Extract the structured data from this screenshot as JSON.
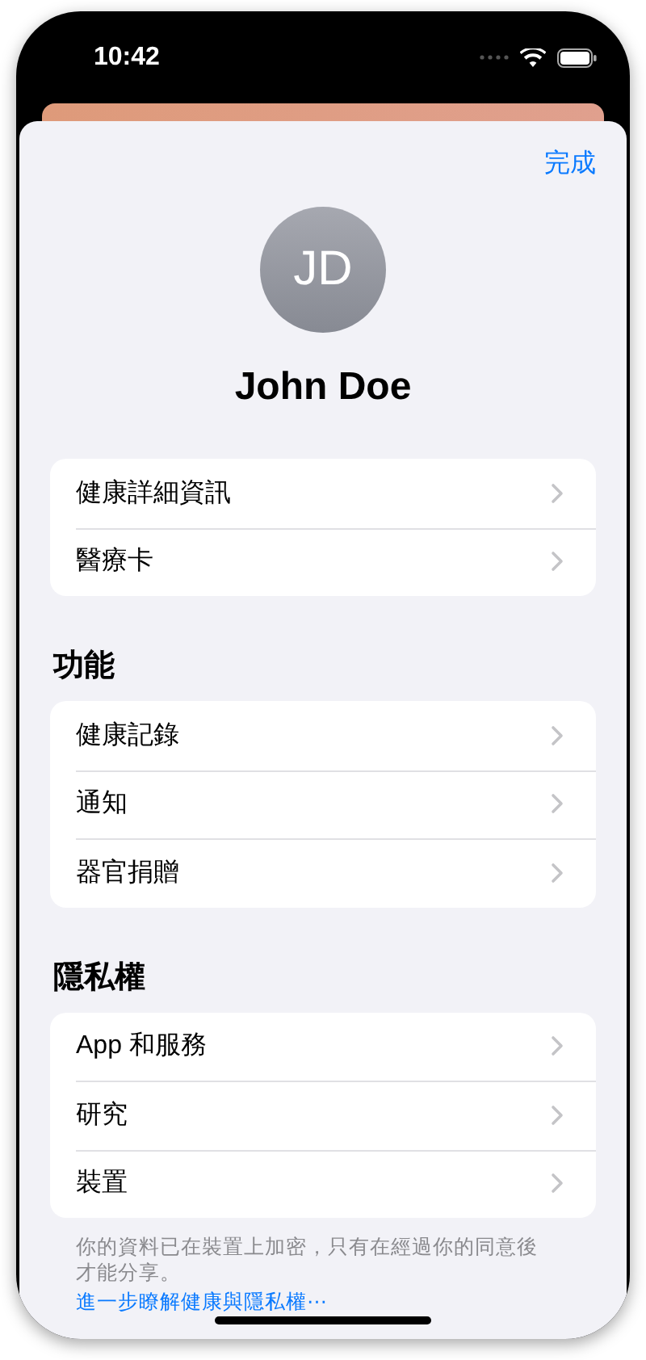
{
  "status_bar": {
    "time": "10:42"
  },
  "sheet": {
    "done_button": "完成",
    "avatar_initials": "JD",
    "name": "John Doe"
  },
  "sections": [
    {
      "items": [
        {
          "label": "健康詳細資訊"
        },
        {
          "label": "醫療卡"
        }
      ]
    },
    {
      "header": "功能",
      "items": [
        {
          "label": "健康記錄"
        },
        {
          "label": "通知"
        },
        {
          "label": "器官捐贈"
        }
      ]
    },
    {
      "header": "隱私權",
      "items": [
        {
          "label": "App 和服務"
        },
        {
          "label": "研究"
        },
        {
          "label": "裝置"
        }
      ],
      "footer": "你的資料已在裝置上加密，只有在經過你的同意後才能分享。",
      "link": "進一步瞭解健康與隱私權⋯"
    }
  ]
}
